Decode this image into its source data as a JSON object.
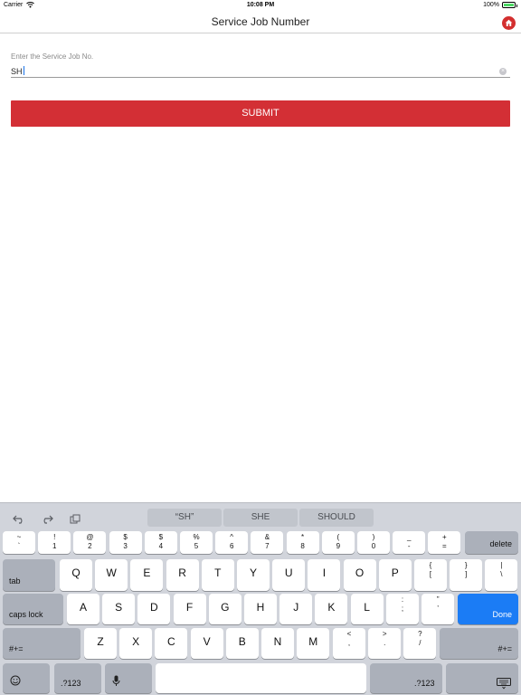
{
  "status_bar": {
    "carrier": "Carrier",
    "time": "10:08 PM",
    "battery": "100%",
    "battery_level": 1.0
  },
  "nav": {
    "title": "Service Job Number",
    "home_icon": "house-icon"
  },
  "form": {
    "label": "Enter the Service Job No.",
    "value": "SH",
    "submit_label": "SUBMIT"
  },
  "colors": {
    "accent": "#d32f35",
    "done_key": "#1b7cf5"
  },
  "keyboard": {
    "suggestions": [
      "“SH”",
      "SHE",
      "SHOULD"
    ],
    "tools": [
      "undo-icon",
      "redo-icon",
      "paste-icon"
    ],
    "number_row": [
      {
        "top": "~",
        "bot": "`"
      },
      {
        "top": "!",
        "bot": "1"
      },
      {
        "top": "@",
        "bot": "2"
      },
      {
        "top": "$",
        "bot": "3"
      },
      {
        "top": "$",
        "bot": "4"
      },
      {
        "top": "%",
        "bot": "5"
      },
      {
        "top": "^",
        "bot": "6"
      },
      {
        "top": "&",
        "bot": "7"
      },
      {
        "top": "*",
        "bot": "8"
      },
      {
        "top": "(",
        "bot": "9"
      },
      {
        "top": ")",
        "bot": "0"
      },
      {
        "top": "_",
        "bot": "-"
      },
      {
        "top": "+",
        "bot": "="
      }
    ],
    "delete": "delete",
    "tab": "tab",
    "row1": [
      "Q",
      "W",
      "E",
      "R",
      "T",
      "Y",
      "U",
      "I",
      "O",
      "P"
    ],
    "row1_extra": [
      {
        "top": "{",
        "bot": "["
      },
      {
        "top": "}",
        "bot": "]"
      },
      {
        "top": "|",
        "bot": "\\"
      }
    ],
    "caps": "caps lock",
    "row2": [
      "A",
      "S",
      "D",
      "F",
      "G",
      "H",
      "J",
      "K",
      "L"
    ],
    "row2_extra": [
      {
        "top": ":",
        "bot": ";"
      },
      {
        "top": "”",
        "bot": "’"
      }
    ],
    "done": "Done",
    "shift_left": "#+=",
    "row3": [
      "Z",
      "X",
      "C",
      "V",
      "B",
      "N",
      "M"
    ],
    "row3_extra": [
      {
        "top": "<",
        "bot": ","
      },
      {
        "top": ">",
        "bot": "."
      },
      {
        "top": "?",
        "bot": "/"
      }
    ],
    "shift_right": "#+=",
    "num_left": ".?123",
    "num_right": ".?123"
  }
}
